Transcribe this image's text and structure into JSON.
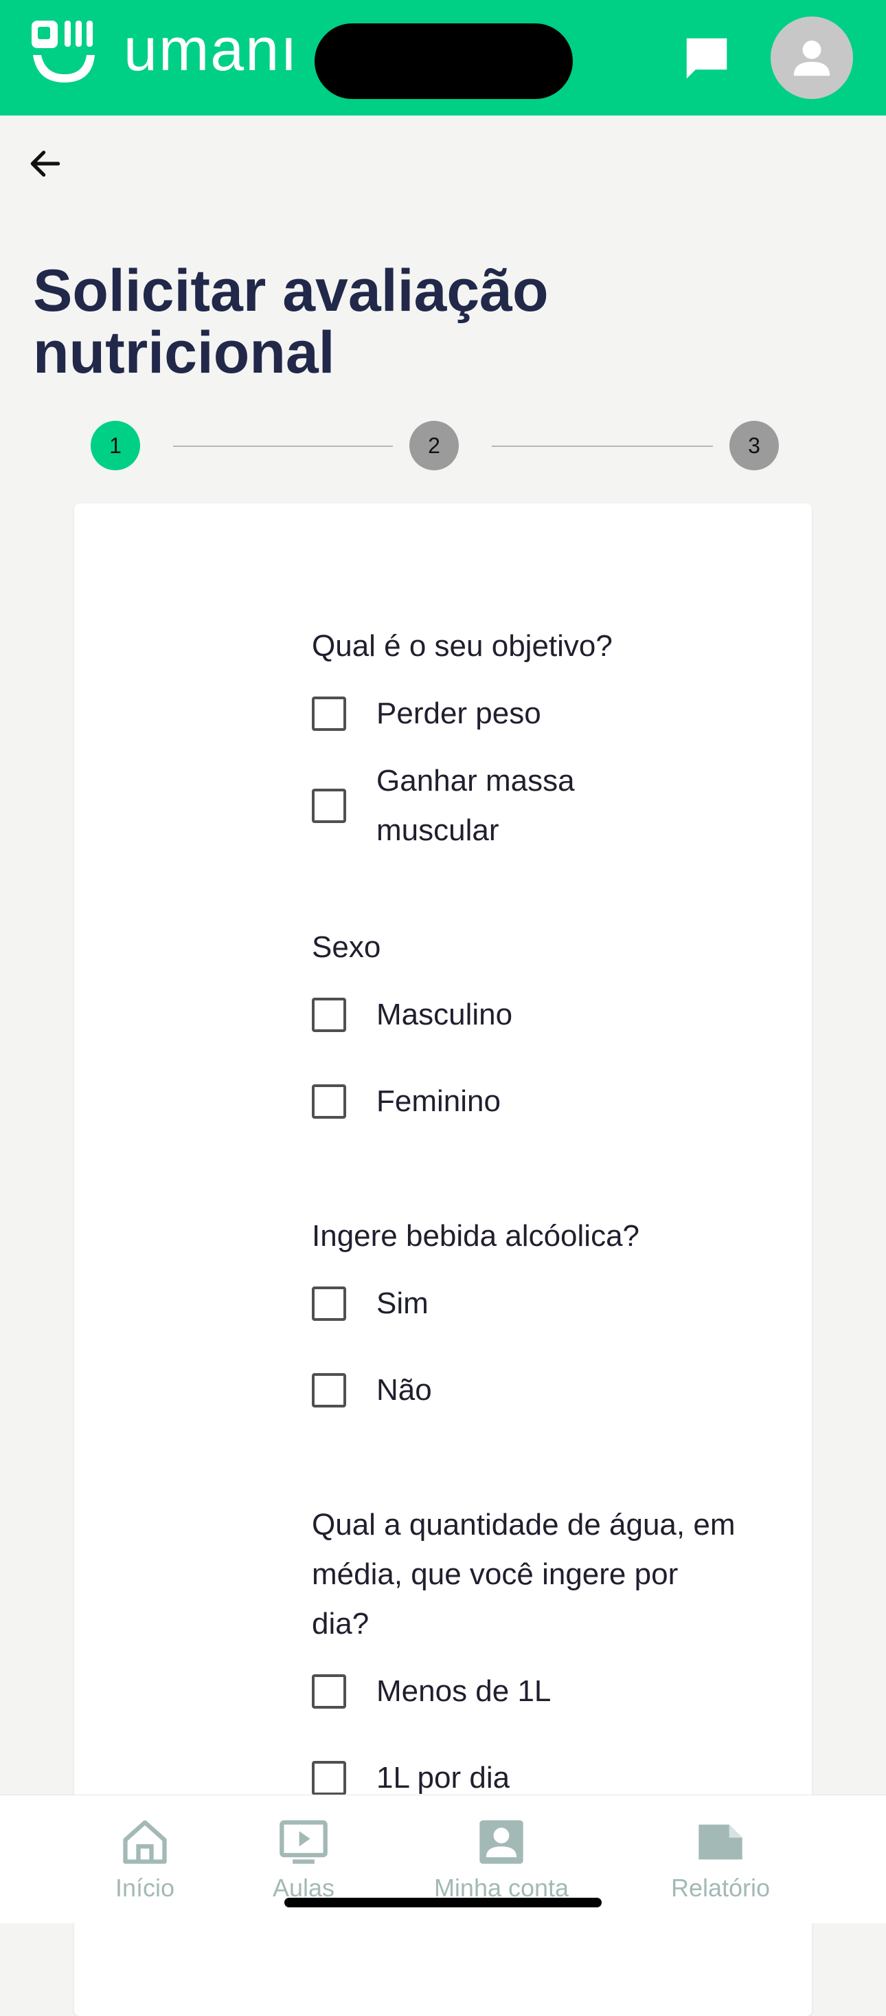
{
  "header": {
    "brand": "umanı",
    "brand_color": "#00cf86",
    "icons": [
      "logo-mark",
      "chat-icon",
      "user-icon"
    ]
  },
  "page": {
    "back_icon": "arrow-left-icon",
    "title": "Solicitar avaliação nutricional"
  },
  "stepper": {
    "current": 1,
    "steps": [
      "1",
      "2",
      "3"
    ],
    "active_color": "#00cf86",
    "inactive_color": "#9b9b9b"
  },
  "form": {
    "q1": {
      "title": "Qual é o seu objetivo?",
      "options": [
        "Perder peso",
        "Ganhar massa muscular"
      ]
    },
    "q2": {
      "title": "Sexo",
      "options": [
        "Masculino",
        "Feminino"
      ]
    },
    "q3": {
      "title": "Ingere bebida alcóolica?",
      "options": [
        "Sim",
        "Não"
      ]
    },
    "q4": {
      "title": "Qual a quantidade de água, em média, que você ingere por dia?",
      "options": [
        "Menos de 1L",
        "1L por dia"
      ]
    }
  },
  "bottom_nav": {
    "items": [
      {
        "label": "Início",
        "icon": "home-icon"
      },
      {
        "label": "Aulas",
        "icon": "video-icon"
      },
      {
        "label": "Minha conta",
        "icon": "account-icon"
      },
      {
        "label": "Relatório",
        "icon": "report-icon"
      }
    ],
    "color": "#a3b9b6"
  }
}
